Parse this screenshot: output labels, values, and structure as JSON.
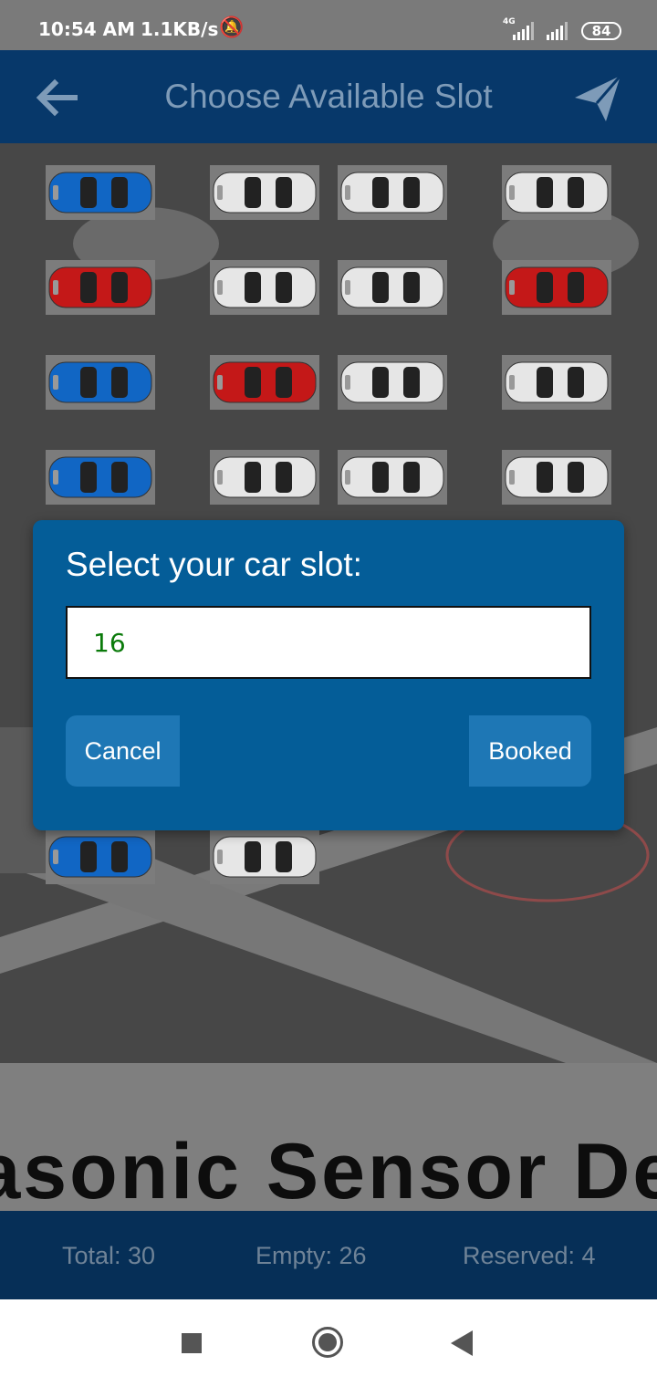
{
  "status_bar": {
    "time": "10:54 AM",
    "net_speed": "1.1KB/s",
    "network_type": "4G",
    "battery": "84",
    "icons": [
      "mute-icon",
      "signal-icon",
      "signal-icon",
      "battery-icon"
    ]
  },
  "app_bar": {
    "title": "Choose Available Slot",
    "back_icon": "arrow-left-icon",
    "action_icon": "send-icon"
  },
  "slots": [
    {
      "color": "blue"
    },
    {
      "color": "white"
    },
    {
      "color": "white"
    },
    {
      "color": "white"
    },
    {
      "color": "red"
    },
    {
      "color": "white"
    },
    {
      "color": "white"
    },
    {
      "color": "red"
    },
    {
      "color": "blue"
    },
    {
      "color": "red"
    },
    {
      "color": "white"
    },
    {
      "color": "white"
    },
    {
      "color": "blue"
    },
    {
      "color": "white"
    },
    {
      "color": "white"
    },
    {
      "color": "white"
    },
    {
      "color": "blue"
    },
    {
      "color": "white"
    }
  ],
  "car_colors": {
    "blue": "#1166c4",
    "red": "#c41818",
    "white": "#e6e6e6"
  },
  "banner": {
    "text": "rasonic Sensor De"
  },
  "dialog": {
    "title": "Select your car slot:",
    "input_value": "16",
    "cancel_label": "Cancel",
    "booked_label": "Booked"
  },
  "footer": {
    "total": "Total: 30",
    "empty": "Empty: 26",
    "reserved": "Reserved: 4"
  },
  "nav": {
    "icons": [
      "recents-icon",
      "home-icon",
      "back-icon"
    ]
  }
}
